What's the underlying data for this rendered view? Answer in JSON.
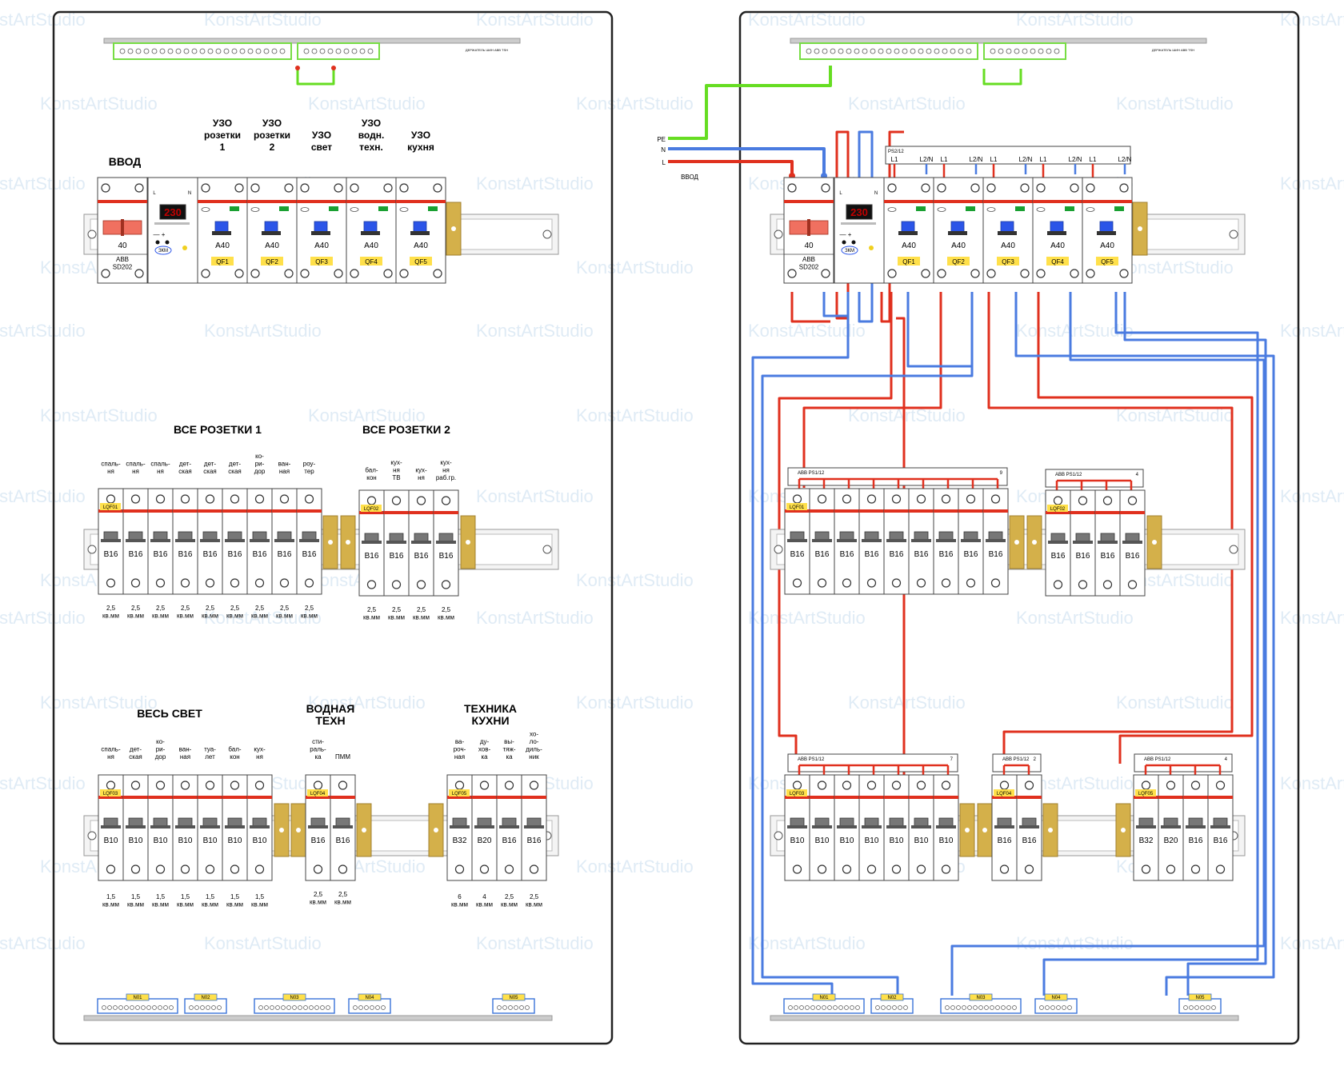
{
  "watermark": "KonstArtStudio",
  "colors": {
    "phase": "#e0301e",
    "neutral": "#4a7be0",
    "pe": "#66dd22",
    "rcd_button": "#2b55e8",
    "busbar_label": "#ffe04a",
    "din_clip": "#d4b04a",
    "main_switch": "#f07060",
    "display": "#c00000"
  },
  "panels": [
    {
      "id": "left",
      "row1": {
        "input_label": "ВВОД",
        "input_breaker": {
          "rating": "40",
          "model": "ABB\nSD202"
        },
        "relay": {
          "display": "230",
          "brand": "ЗКМ"
        },
        "rcd_titles": [
          "УЗО\nрозетки\n1",
          "УЗО\nрозетки\n2",
          "УЗО\nсвет",
          "УЗО\nводн.\nтехн.",
          "УЗО\nкухня"
        ],
        "rcd_ratings": [
          "A40",
          "A40",
          "A40",
          "A40",
          "A40"
        ],
        "rcd_tags": [
          "QF1",
          "QF2",
          "QF3",
          "QF4",
          "QF5"
        ]
      },
      "row2": {
        "group_titles": [
          "ВСЕ РОЗЕТКИ 1",
          "ВСЕ РОЗЕТКИ 2"
        ],
        "group1": {
          "tag": "LQF01",
          "labels": [
            "спаль-\nня",
            "спаль-\nня",
            "спаль-\nня",
            "дет-\nская",
            "дет-\nская",
            "дет-\nская",
            "ко-\nри-\nдор",
            "ван-\nная",
            "роу-\nтер"
          ],
          "ratings": [
            "B16",
            "B16",
            "B16",
            "B16",
            "B16",
            "B16",
            "B16",
            "B16",
            "B16"
          ],
          "cables": [
            "2,5\nкв.мм",
            "2,5\nкв.мм",
            "2,5\nкв.мм",
            "2,5\nкв.мм",
            "2,5\nкв.мм",
            "2,5\nкв.мм",
            "2,5\nкв.мм",
            "2,5\nкв.мм",
            "2,5\nкв.мм"
          ]
        },
        "group2": {
          "tag": "LQF02",
          "labels": [
            "бал-\nкон",
            "кух-\nня\nТВ",
            "кух-\nня",
            "кух-\nня\nраб.гр."
          ],
          "ratings": [
            "B16",
            "B16",
            "B16",
            "B16"
          ],
          "cables": [
            "2,5\nкв.мм",
            "2,5\nкв.мм",
            "2,5\nкв.мм",
            "2,5\nкв.мм"
          ]
        }
      },
      "row3": {
        "group_titles": [
          "ВЕСЬ СВЕТ",
          "ВОДНАЯ\nТЕХН",
          "ТЕХНИКА\nКУХНИ"
        ],
        "group1": {
          "tag": "LQF03",
          "labels": [
            "спаль-\nня",
            "дет-\nская",
            "ко-\nри-\nдор",
            "ван-\nная",
            "туа-\nлет",
            "бал-\nкон",
            "кух-\nня"
          ],
          "ratings": [
            "B10",
            "B10",
            "B10",
            "B10",
            "B10",
            "B10",
            "B10"
          ],
          "cables": [
            "1,5\nкв.мм",
            "1,5\nкв.мм",
            "1,5\nкв.мм",
            "1,5\nкв.мм",
            "1,5\nкв.мм",
            "1,5\nкв.мм",
            "1,5\nкв.мм"
          ]
        },
        "group2": {
          "tag": "LQF04",
          "labels": [
            "сти-\nраль-\nка",
            "ПММ"
          ],
          "ratings": [
            "B16",
            "B16"
          ],
          "cables": [
            "2,5\nкв.мм",
            "2,5\nкв.мм"
          ]
        },
        "group3": {
          "tag": "LQF05",
          "labels": [
            "ва-\nроч-\nная",
            "ду-\nхов-\nка",
            "вы-\nтяж-\nка",
            "хо-\nло-\nдиль-\nник"
          ],
          "ratings": [
            "B32",
            "B20",
            "B16",
            "B16"
          ],
          "cables": [
            "6\nкв.мм",
            "4\nкв.мм",
            "2,5\nкв.мм",
            "2,5\nкв.мм"
          ]
        }
      },
      "neutral_bars": [
        "N01",
        "N02",
        "N03",
        "N04",
        "N05"
      ]
    },
    {
      "id": "right",
      "feed_labels": [
        "PE",
        "N",
        "L",
        "ВВОД"
      ],
      "bus_top": {
        "name": "PS2/12",
        "labels": [
          "L1",
          "L2/N",
          "L1",
          "L2/N",
          "L1",
          "L2/N",
          "L1",
          "L2/N",
          "L1",
          "L2/N"
        ]
      },
      "row1": {
        "input_breaker": {
          "rating": "40",
          "model": "ABB\nSD202"
        },
        "relay": {
          "display": "230",
          "brand": "ЗКМ"
        },
        "rcd_ratings": [
          "A40",
          "A40",
          "A40",
          "A40",
          "A40"
        ],
        "rcd_tags": [
          "QF1",
          "QF2",
          "QF3",
          "QF4",
          "QF5"
        ]
      },
      "row2": {
        "bus1": {
          "name": "ABB  PS1/12",
          "count": "9"
        },
        "bus2": {
          "name": "ABB  PS1/12",
          "count": "4"
        },
        "group1": {
          "tag": "LQF01",
          "ratings": [
            "B16",
            "B16",
            "B16",
            "B16",
            "B16",
            "B16",
            "B16",
            "B16",
            "B16"
          ]
        },
        "group2": {
          "tag": "LQF02",
          "ratings": [
            "B16",
            "B16",
            "B16",
            "B16"
          ]
        }
      },
      "row3": {
        "bus1": {
          "name": "ABB  PS1/12",
          "count": "7"
        },
        "bus2": {
          "name": "ABB  PS1/12",
          "count": "2"
        },
        "bus3": {
          "name": "ABB  PS1/12",
          "count": "4"
        },
        "group1": {
          "tag": "LQF03",
          "ratings": [
            "B10",
            "B10",
            "B10",
            "B10",
            "B10",
            "B10",
            "B10"
          ]
        },
        "group2": {
          "tag": "LQF04",
          "ratings": [
            "B16",
            "B16"
          ]
        },
        "group3": {
          "tag": "LQF05",
          "ratings": [
            "B32",
            "B20",
            "B16",
            "B16"
          ]
        }
      },
      "neutral_bars": [
        "N01",
        "N02",
        "N03",
        "N04",
        "N05"
      ]
    }
  ],
  "rail_caption": "ДЕРЖАТЕЛЬ ШИН ABB TSH"
}
